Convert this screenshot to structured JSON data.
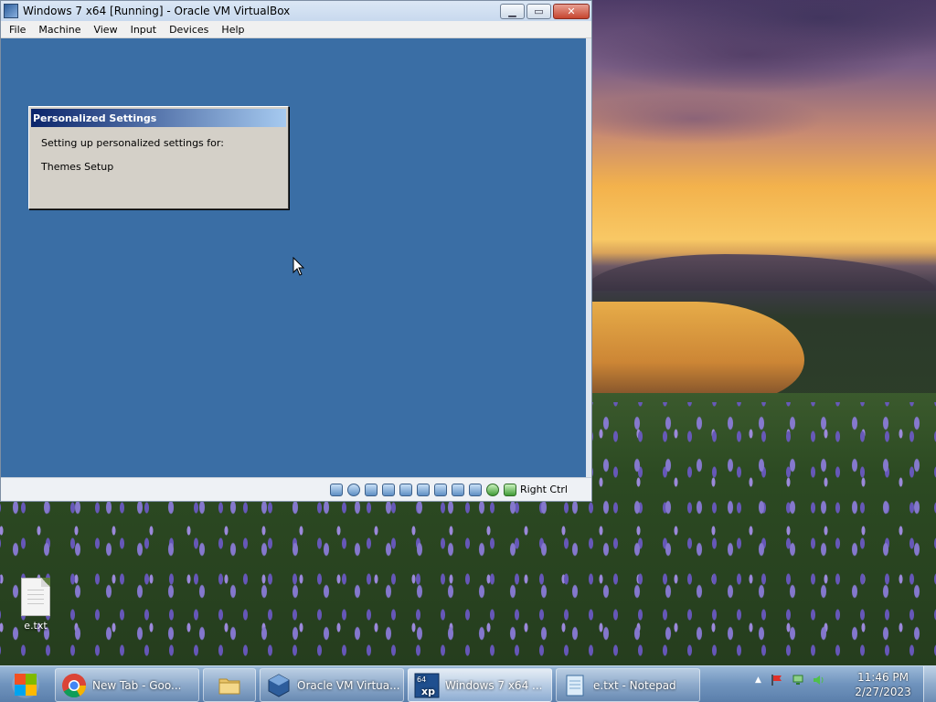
{
  "vbox": {
    "title": "Windows 7 x64  [Running] - Oracle VM VirtualBox",
    "menu": [
      "File",
      "Machine",
      "View",
      "Input",
      "Devices",
      "Help"
    ],
    "host_key": "Right Ctrl"
  },
  "dialog": {
    "title": "Personalized Settings",
    "line1": "Setting up personalized settings for:",
    "line2": "Themes Setup"
  },
  "desktop": {
    "icon_label": "e.txt"
  },
  "taskbar": {
    "items": [
      {
        "label": "New Tab - Goo...",
        "icon": "chrome-icon"
      },
      {
        "label": "",
        "icon": "folder-icon"
      },
      {
        "label": "Oracle VM Virtua...",
        "icon": "virtualbox-icon"
      },
      {
        "label": "Windows 7 x64 ...",
        "icon": "xp-vm-icon",
        "badge": "64"
      },
      {
        "label": "e.txt - Notepad",
        "icon": "notepad-icon"
      }
    ],
    "time": "11:46 PM",
    "date": "2/27/2023"
  },
  "colors": {
    "guest_background": "#3a6ea5",
    "dialog_title_start": "#0a246a",
    "dialog_title_end": "#a6caf0"
  }
}
